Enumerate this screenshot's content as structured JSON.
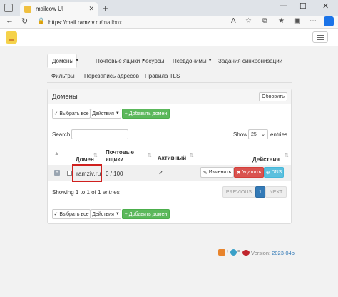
{
  "browser": {
    "tab_title": "mailcow UI",
    "tab_close": "✕",
    "new_tab": "+",
    "win_min": "—",
    "win_max": "☐",
    "win_close": "✕",
    "url_host": "https://mail.ramziv.ru",
    "url_path": "/mailbox"
  },
  "nav": {
    "row1": [
      {
        "label": "Домены",
        "caret": true,
        "active": true
      },
      {
        "label": "Почтовые ящики",
        "caret": true
      },
      {
        "label": "Ресурсы"
      },
      {
        "label": "Псевдонимы",
        "caret": true
      },
      {
        "label": "Задания синхронизации"
      }
    ],
    "row2": [
      {
        "label": "Фильтры"
      },
      {
        "label": "Перезапись адресов"
      },
      {
        "label": "Правила TLS"
      }
    ]
  },
  "panel": {
    "title": "Домены",
    "refresh_label": "Обновить"
  },
  "toolbar": {
    "select_all": "Выбрать все",
    "actions": "Действия",
    "add_domain": "Добавить домен"
  },
  "table": {
    "search_label": "Search:",
    "search_value": "",
    "show_label": "Show",
    "page_size": "25",
    "entries_label": "entries",
    "headers": {
      "domain": "Домен",
      "mailboxes_line1": "Почтовые",
      "mailboxes_line2": "ящики",
      "active": "Активный",
      "actions": "Действия"
    },
    "rows": [
      {
        "domain": "ramziv.ru",
        "mailboxes": "0 / 100",
        "active": "✓",
        "edit": "Изменить",
        "delete": "Удалить",
        "dns": "DNS"
      }
    ],
    "info": "Showing 1 to 1 of 1 entries",
    "prev": "PREVIOUS",
    "page": "1",
    "next": "NEXT"
  },
  "footer": {
    "version_label": "Version:",
    "version_value": "2023-04b"
  },
  "colors": {
    "success": "#5cb85c",
    "danger": "#d9534f",
    "info": "#5bc0de",
    "primary": "#337ab7",
    "highlight": "#d0201e"
  }
}
